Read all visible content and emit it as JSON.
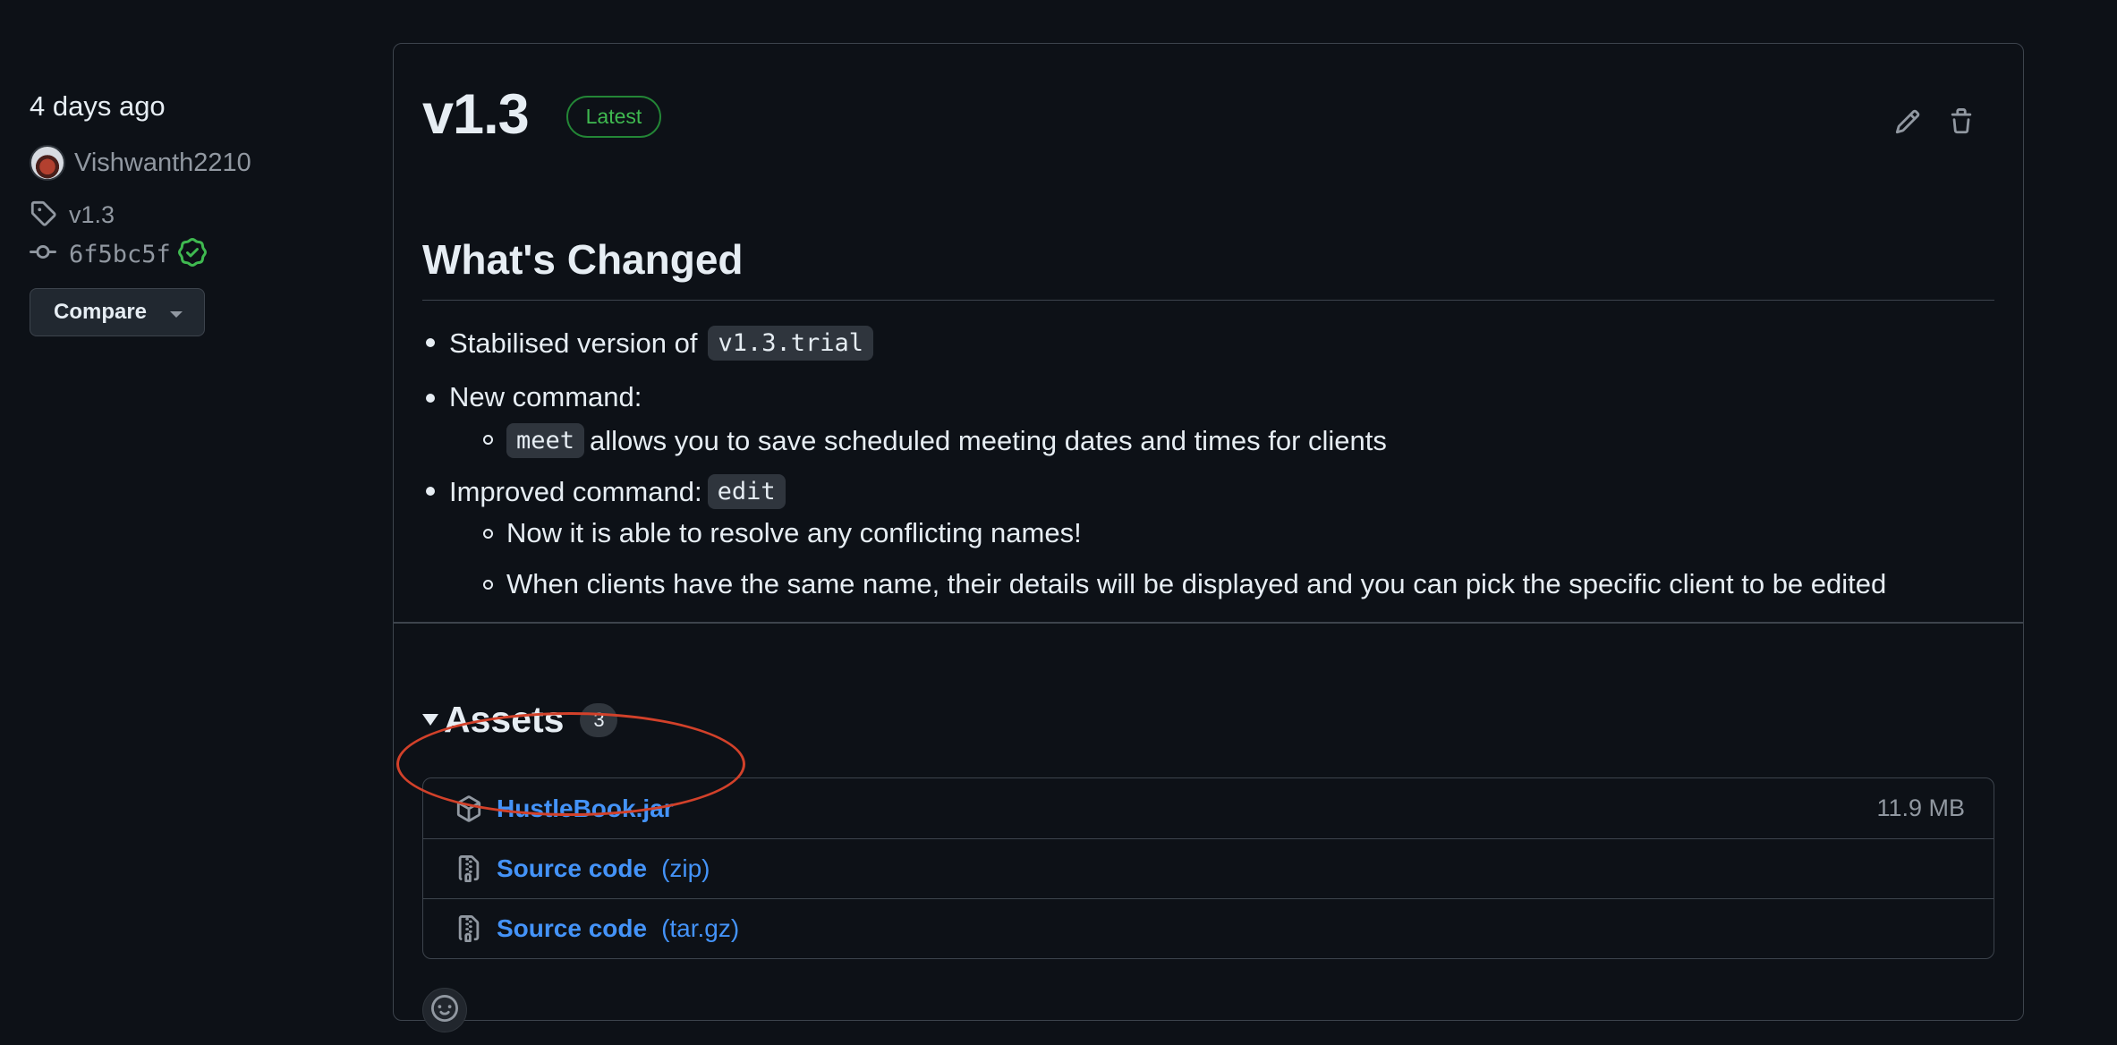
{
  "sidebar": {
    "date": "4 days ago",
    "author": "Vishwanth2210",
    "tag": "v1.3",
    "commit": "6f5bc5f",
    "compare_label": "Compare"
  },
  "release": {
    "title": "v1.3",
    "badge": "Latest",
    "notes_heading": "What's Changed",
    "notes": {
      "item1_text": "Stabilised version of",
      "item1_code": "v1.3.trial",
      "item2_text": "New command:",
      "item2_sub_code": "meet",
      "item2_sub_text": "allows you to save scheduled meeting dates and times for clients",
      "item3_text": "Improved command:",
      "item3_code": "edit",
      "item3_sub1": "Now it is able to resolve any conflicting names!",
      "item3_sub2": "When clients have the same name, their details will be displayed and you can pick the specific client to be edited"
    }
  },
  "assets": {
    "title": "Assets",
    "count": "3",
    "items": [
      {
        "name": "HustleBook.jar",
        "ext": "",
        "size": "11.9 MB",
        "icon": "package-icon"
      },
      {
        "name": "Source code",
        "ext": "(zip)",
        "size": "",
        "icon": "file-zip-icon"
      },
      {
        "name": "Source code",
        "ext": "(tar.gz)",
        "size": "",
        "icon": "file-zip-icon"
      }
    ]
  },
  "colors": {
    "background": "#0d1117",
    "link": "#4493f8",
    "latest_green": "#3fb950",
    "highlight_red": "#d2412a"
  }
}
